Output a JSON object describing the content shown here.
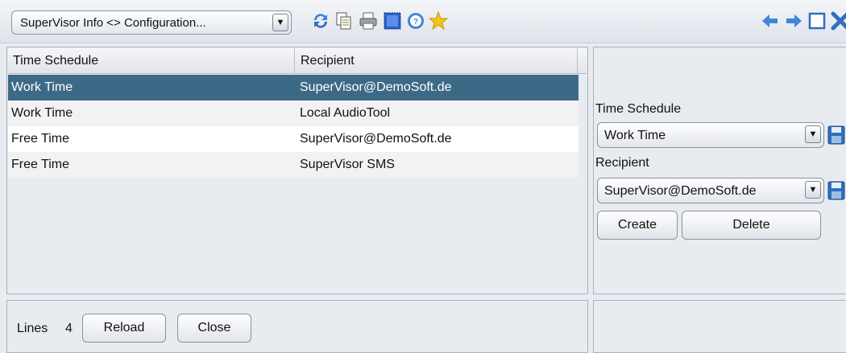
{
  "toolbar": {
    "view_select": "SuperVisor Info <> Configuration...",
    "dropdown_arrow": "▼",
    "icons": [
      "refresh-icon",
      "copy-icon",
      "print-icon",
      "select-all-icon",
      "help-icon",
      "favorite-star-icon",
      "back-arrow-icon",
      "forward-arrow-icon",
      "maximize-icon",
      "close-icon"
    ]
  },
  "table": {
    "columns": [
      "Time Schedule",
      "Recipient"
    ],
    "rows": [
      {
        "schedule": "Work Time",
        "recipient": "SuperVisor@DemoSoft.de",
        "selected": true
      },
      {
        "schedule": "Work Time",
        "recipient": "Local AudioTool",
        "selected": false
      },
      {
        "schedule": "Free Time",
        "recipient": "SuperVisor@DemoSoft.de",
        "selected": false
      },
      {
        "schedule": "Free Time",
        "recipient": "SuperVisor SMS",
        "selected": false
      }
    ]
  },
  "form": {
    "schedule_label": "Time Schedule",
    "schedule_value": "Work Time",
    "recipient_label": "Recipient",
    "recipient_value": "SuperVisor@DemoSoft.de",
    "create_label": "Create",
    "delete_label": "Delete"
  },
  "footer": {
    "lines_label": "Lines",
    "lines_count": "4",
    "reload_label": "Reload",
    "close_label": "Close"
  },
  "colors": {
    "selection": "#3c6a86",
    "panel_bg": "#e8ebf0",
    "toolbar_arrows": "#3f86d8",
    "star": "#f5c518"
  }
}
